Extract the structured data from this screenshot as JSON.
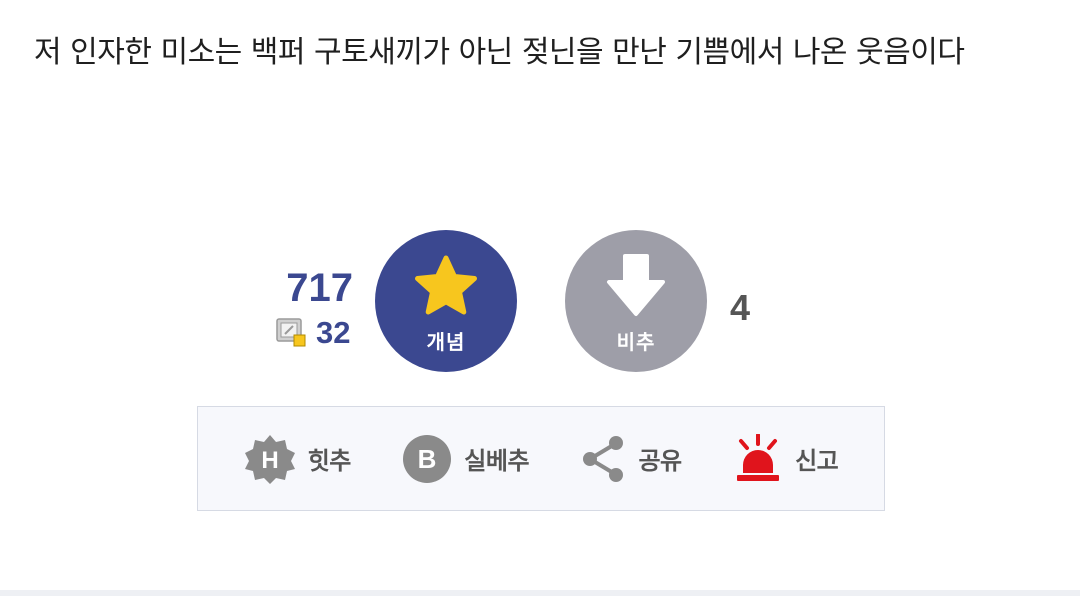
{
  "post": {
    "text": "저 인자한 미소는 백퍼 구토새끼가 아닌 젖닌을 만난 기쁨에서 나온 웃음이다"
  },
  "votes": {
    "up_count": "717",
    "fixed_count": "32",
    "up_label": "개념",
    "down_label": "비추",
    "down_count": "4"
  },
  "actions": [
    {
      "label": "힛추",
      "icon": "hit-badge-icon"
    },
    {
      "label": "실베추",
      "icon": "best-b-icon"
    },
    {
      "label": "공유",
      "icon": "share-icon"
    },
    {
      "label": "신고",
      "icon": "siren-icon"
    }
  ],
  "colors": {
    "accent_blue": "#3b4890",
    "downvote_gray": "#9e9ea8",
    "star_yellow": "#f7c61e",
    "siren_red": "#e0141c"
  }
}
